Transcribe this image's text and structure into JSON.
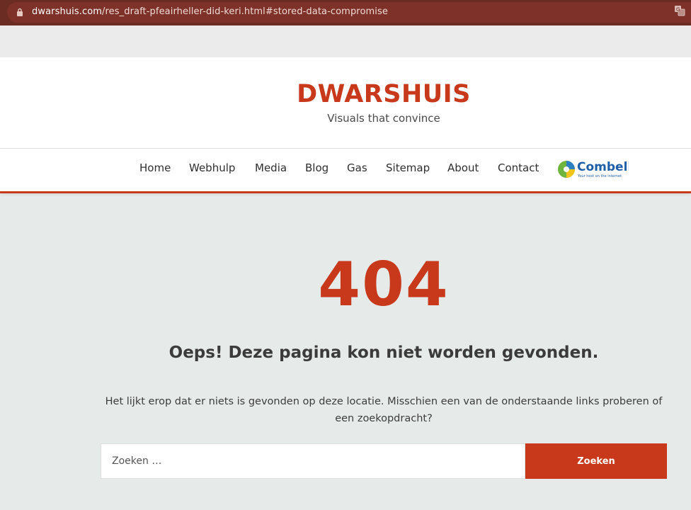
{
  "browser": {
    "url_host": "dwarshuis.com",
    "url_path": "/res_draft-pfeairheller-did-keri.html#stored-data-compromise",
    "lock_icon": "lock-icon",
    "translate_icon": "translate-icon"
  },
  "header": {
    "site_title": "DWARSHUIS",
    "tagline": "Visuals that convince"
  },
  "nav": {
    "items": [
      {
        "label": "Home"
      },
      {
        "label": "Webhulp"
      },
      {
        "label": "Media"
      },
      {
        "label": "Blog"
      },
      {
        "label": "Gas"
      },
      {
        "label": "Sitemap"
      },
      {
        "label": "About"
      },
      {
        "label": "Contact"
      }
    ],
    "sponsor_logo_text": "Combell",
    "sponsor_logo_subtext": "Your host on the internet"
  },
  "main": {
    "error_code": "404",
    "error_title": "Oeps! Deze pagina kon niet worden gevonden.",
    "error_description": "Het lijkt erop dat er niets is gevonden op deze locatie. Misschien een van de onderstaande links proberen of een zoekopdracht?",
    "search": {
      "placeholder": "Zoeken …",
      "button_label": "Zoeken"
    }
  },
  "colors": {
    "accent": "#c8391c",
    "browser_bar": "#6b2c24",
    "background": "#e6ebea"
  }
}
